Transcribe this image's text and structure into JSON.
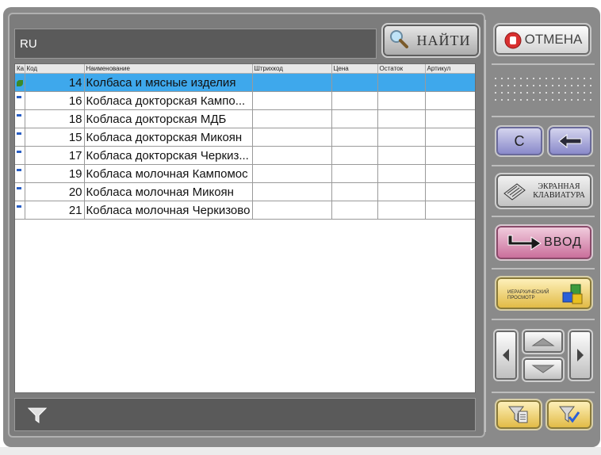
{
  "search": {
    "value": "RU"
  },
  "buttons": {
    "find": "НАЙТИ",
    "cancel": "ОТМЕНА",
    "clear": "C",
    "keyboard_line1": "ЭКРАННАЯ",
    "keyboard_line2": "КЛАВИАТУРА",
    "enter": "ВВОД",
    "hier_line1": "Иерархический",
    "hier_line2": "просмотр"
  },
  "table": {
    "columns": [
      "Ка...",
      "Код",
      "Наименование",
      "Штрихкод",
      "Цена",
      "Остаток",
      "Артикул"
    ],
    "rows": [
      {
        "code": "14",
        "name": "Колбаса и мясные изделия",
        "selected": true
      },
      {
        "code": "16",
        "name": "Кобласа докторская Кампо..."
      },
      {
        "code": "18",
        "name": "Кобласа докторская МДБ"
      },
      {
        "code": "15",
        "name": "Кобласа докторская Микоян"
      },
      {
        "code": "17",
        "name": "Кобласа докторская Черкиз..."
      },
      {
        "code": "19",
        "name": "Кобласа молочная Кампомос"
      },
      {
        "code": "20",
        "name": "Кобласа молочная Микоян"
      },
      {
        "code": "21",
        "name": "Кобласа молочная Черкизово"
      }
    ]
  },
  "colors": {
    "selected_row": "#3ea8ec",
    "frame": "#8a8a8a",
    "panel_dark": "#5a5a5a",
    "enter_button": "#c86a98",
    "nav_button_blue": "#8585c8",
    "filter_button_yellow": "#e0b840"
  },
  "icons": {
    "find": "magnifier-icon",
    "cancel": "stop-hand-icon",
    "back": "backspace-arrow-icon",
    "keyboard": "keyboard-icon",
    "enter": "enter-arrow-icon",
    "hier": "cubes-icon",
    "filter": "funnel-icon"
  }
}
